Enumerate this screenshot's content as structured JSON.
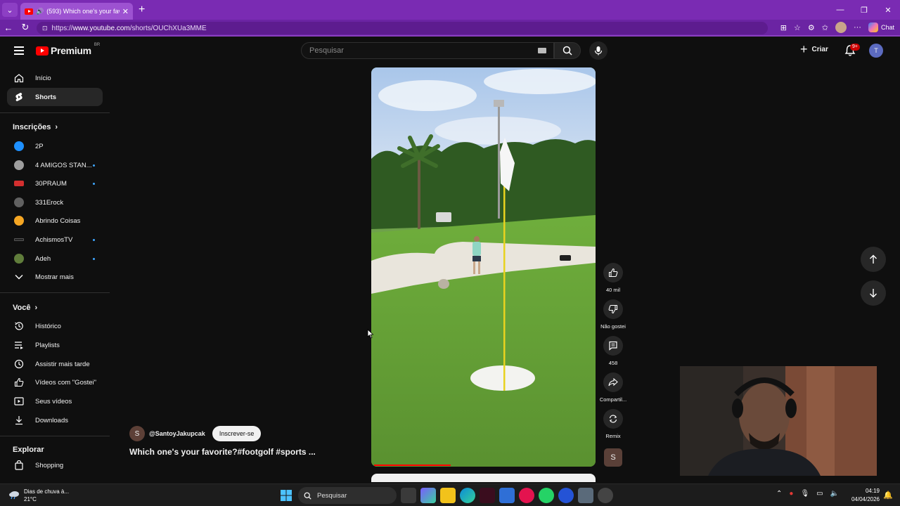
{
  "browser": {
    "tab_title": "(593) Which one's your favori",
    "url_prefix": "https://",
    "url_host": "www.youtube.com",
    "url_path": "/shorts/OUChXUa3MME",
    "chat_label": "Chat"
  },
  "header": {
    "logo_text": "Premium",
    "logo_region": "BR",
    "search_placeholder": "Pesquisar",
    "create_label": "Criar",
    "notif_count": "9+",
    "user_initial": "T"
  },
  "sidebar": {
    "top": [
      {
        "label": "Início",
        "icon": "home-icon"
      },
      {
        "label": "Shorts",
        "icon": "shorts-icon",
        "active": true
      }
    ],
    "subs_heading": "Inscrições",
    "subs": [
      {
        "label": "2P",
        "color": "#1e90ff",
        "dot": false
      },
      {
        "label": "4 AMIGOS STAN...",
        "color": "#9e9e9e",
        "dot": true
      },
      {
        "label": "30PRAUM",
        "color": "#d32f2f",
        "dot": true
      },
      {
        "label": "331Erock",
        "color": "#616161",
        "dot": false
      },
      {
        "label": "Abrindo Coisas",
        "color": "#f5a623",
        "dot": false
      },
      {
        "label": "AchismosTV",
        "color": "#222222",
        "dot": true
      },
      {
        "label": "Adeh",
        "color": "#607d3b",
        "dot": true
      }
    ],
    "show_more": "Mostrar mais",
    "you_heading": "Você",
    "you": [
      {
        "label": "Histórico",
        "icon": "history-icon"
      },
      {
        "label": "Playlists",
        "icon": "playlists-icon"
      },
      {
        "label": "Assistir mais tarde",
        "icon": "watch-later-icon"
      },
      {
        "label": "Vídeos com \"Gostei\"",
        "icon": "liked-icon"
      },
      {
        "label": "Seus vídeos",
        "icon": "your-videos-icon"
      },
      {
        "label": "Downloads",
        "icon": "downloads-icon"
      }
    ],
    "explore_heading": "Explorar",
    "explore": [
      {
        "label": "Shopping",
        "icon": "shopping-icon"
      }
    ]
  },
  "short": {
    "channel_initial": "S",
    "channel": "@SantoyJakupcak",
    "subscribe": "Inscrever-se",
    "title": "Which one's your favorite?#footgolf #sports ...",
    "progress": 0.35,
    "likes": "40 mil",
    "dislike": "Não gostei",
    "comments": "458",
    "share": "Compartil...",
    "remix": "Remix",
    "audio_initial": "S"
  },
  "taskbar": {
    "weather_line1": "Dias de chuva à...",
    "weather_line2": "21°C",
    "search_label": "Pesquisar",
    "time": "04:19",
    "date": "04/04/2026"
  }
}
